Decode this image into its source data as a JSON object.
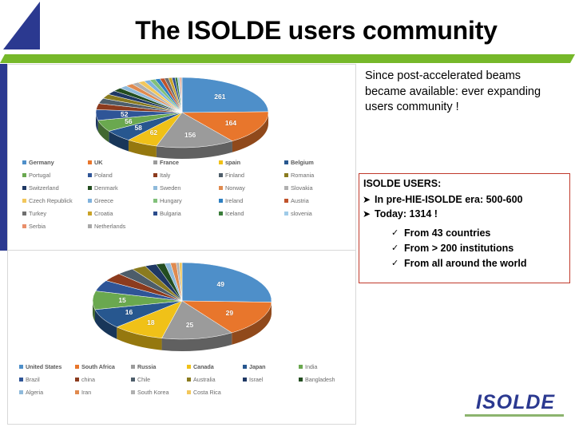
{
  "slide": {
    "title": "The ISOLDE users community",
    "logo_triangle_color": "#2b3990",
    "accent_green": "#76b82a",
    "accent_blue": "#2b3990",
    "red_box_border": "#c0392b"
  },
  "intro": {
    "text": "Since post-accelerated beams became available: ever expanding users community !"
  },
  "users_box": {
    "header": "ISOLDE USERS:",
    "bullets": [
      {
        "mark": "➤",
        "text": "In pre-HIE-ISOLDE era: 500-600"
      },
      {
        "mark": "➤",
        "text": "Today: 1314 !"
      }
    ],
    "sub_bullets": [
      {
        "mark": "✓",
        "text": "From 43 countries"
      },
      {
        "mark": "✓",
        "text": "From > 200 institutions"
      },
      {
        "mark": "✓",
        "text": "From all around the world"
      }
    ]
  },
  "brand": {
    "logo_text": "ISOLDE"
  },
  "chart_data": [
    {
      "type": "pie",
      "id": "european-users",
      "title": "",
      "legend_position": "bottom",
      "labels_shown": [
        261,
        164,
        156,
        62,
        58,
        56,
        52
      ],
      "categories": [
        "Germany",
        "UK",
        "France",
        "spain",
        "Belgium",
        "Portugal",
        "Poland",
        "Italy",
        "Finland",
        "Romania",
        "Switzerland",
        "Denmark",
        "Sweden",
        "Norway",
        "Slovakia",
        "Czech Republick",
        "Greece",
        "Hungary",
        "Ireland",
        "Austria",
        "Turkey",
        "Croatia",
        "Bulgaria",
        "Iceland",
        "slovenia",
        "Serbia",
        "Netherlands"
      ],
      "values": [
        261,
        164,
        156,
        62,
        58,
        56,
        52,
        30,
        26,
        22,
        20,
        18,
        16,
        15,
        14,
        13,
        12,
        11,
        10,
        9,
        8,
        7,
        6,
        5,
        4,
        3,
        2
      ],
      "colors": [
        "#4e8fc9",
        "#e8762c",
        "#9b9b9b",
        "#f0c118",
        "#27578f",
        "#6aa84f",
        "#2f5597",
        "#8c3b1e",
        "#4d5d6a",
        "#8a7b1f",
        "#1f3864",
        "#234d20",
        "#8fbadb",
        "#e08a4f",
        "#b0b0b0",
        "#f2c75c",
        "#7fb2dd",
        "#81c07a",
        "#2d7fc1",
        "#c0522a",
        "#6f6f6f",
        "#c9a227",
        "#2b4c8c",
        "#3a7d3a",
        "#9fcbe8",
        "#e98f6b",
        "#a8a8a8"
      ]
    },
    {
      "type": "pie",
      "id": "non-european-users",
      "title": "",
      "legend_position": "bottom",
      "labels_shown": [
        49,
        29,
        25,
        18,
        16,
        15
      ],
      "categories": [
        "United States",
        "South Africa",
        "Russia",
        "Canada",
        "Japan",
        "India",
        "Brazil",
        "china",
        "Chile",
        "Australia",
        "Israel",
        "Bangladesh",
        "Algeria",
        "Iran",
        "South Korea",
        "Costa Rica"
      ],
      "values": [
        49,
        29,
        25,
        18,
        16,
        15,
        9,
        7,
        6,
        5,
        4,
        3,
        2,
        2,
        1,
        1
      ],
      "colors": [
        "#4e8fc9",
        "#e8762c",
        "#9b9b9b",
        "#f0c118",
        "#27578f",
        "#6aa84f",
        "#2f5597",
        "#8c3b1e",
        "#4d5d6a",
        "#8a7b1f",
        "#1f3864",
        "#234d20",
        "#8fbadb",
        "#e08a4f",
        "#b0b0b0",
        "#f2c75c"
      ]
    }
  ]
}
